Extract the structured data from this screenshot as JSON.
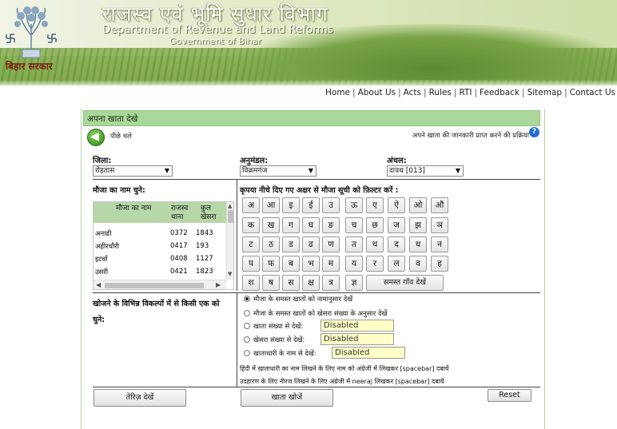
{
  "header": {
    "title_hindi": "राजस्व एवं भूमि सुधार विभाग",
    "title_english": "Department of Revenue and Land Reforms",
    "subtitle": "Government of Bihar",
    "gov_label": "बिहार सरकार",
    "nav": [
      "Home",
      "About Us",
      "Acts",
      "Rules",
      "RTI",
      "Feedback",
      "Sitemap",
      "Contact Us"
    ]
  },
  "panel": {
    "heading": "अपना खाता देखे",
    "back_label": "पीछे चले",
    "process_link": "अपने खाता की जानकारी प्राप्त करने की प्रक्रिया",
    "help_icon": "?"
  },
  "filters": {
    "district_label": "जिला:",
    "district_value": "रोहतास",
    "subdivision_label": "अनुमंडल:",
    "subdivision_value": "विक्रमगंज",
    "circle_label": "अंचल:",
    "circle_value": "दावथ [013]"
  },
  "mauza": {
    "label": "मौजा का नाम चुने:",
    "columns": [
      "मौजा का नाम",
      "राजस्व थाना",
      "कुल खेसरा"
    ],
    "rows": [
      {
        "name": "अनाढी",
        "thana": "0372",
        "khesra": "1843"
      },
      {
        "name": "अहीरचौरी",
        "thana": "0417",
        "khesra": "193"
      },
      {
        "name": "इटवाँ",
        "thana": "0408",
        "khesra": "1127"
      },
      {
        "name": "उसरी",
        "thana": "0421",
        "khesra": "1823"
      }
    ]
  },
  "alphabet": {
    "label": "कृपया नीचे दिए गए अक्षर से मौजा सूची को फ़िल्टर करें :",
    "rows": [
      [
        "अ",
        "आ",
        "इ",
        "ई",
        "उ",
        "ऊ",
        "ए",
        "ऐ",
        "ओ",
        "औ"
      ],
      [
        "क",
        "ख",
        "ग",
        "घ",
        "ङ",
        "च",
        "छ",
        "ज",
        "झ",
        "ञ"
      ],
      [
        "ट",
        "ठ",
        "ड",
        "ढ",
        "ण",
        "त",
        "थ",
        "द",
        "ध",
        "न"
      ],
      [
        "प",
        "फ",
        "ब",
        "भ",
        "म",
        "य",
        "र",
        "ल",
        "व",
        "ह"
      ],
      [
        "श",
        "ष",
        "स",
        "क्ष",
        "त्र",
        "ज्ञ"
      ]
    ],
    "all_button": "समस्त गाँव देखें"
  },
  "search": {
    "label": "खोजने के विभिन्न विकल्पों में से किसी एक को चुने:",
    "options": [
      {
        "label": "मौजा के समस्त खातों को नामानुसार देखें",
        "selected": true
      },
      {
        "label": "मौजा के समस्त खातों को खेसरा संख्या के अनुसार देखें",
        "selected": false
      },
      {
        "label": "खाता संख्या से देखें:",
        "selected": false,
        "field": "Disabled"
      },
      {
        "label": "खेसरा संख्या से देखें:",
        "selected": false,
        "field": "Disabled"
      },
      {
        "label": "खाताधारी के नाम से देखें:",
        "selected": false,
        "field": "Disabled"
      }
    ],
    "hint_1": "हिंदी में खाताधारी का नाम लिखने के लिए नाम को अंग्रेजी में लिखकर [spacebar] दबायें",
    "hint_2": "उदहारण के लिए नीरज लिखने के लिए अंग्रेजी में neeraj लिखकर [spacebar] दबायें"
  },
  "buttons": {
    "register": "तेरिज़ देखें",
    "search": "खाता खोजें",
    "reset": "Reset"
  }
}
